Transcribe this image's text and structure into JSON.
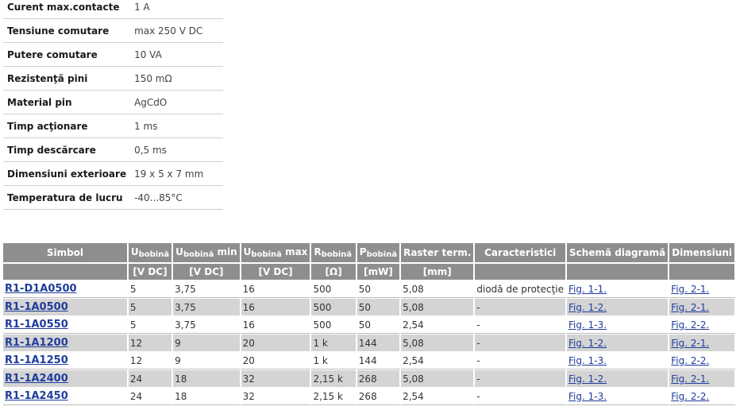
{
  "specs": [
    {
      "label": "Curent max.contacte",
      "value": "1 A"
    },
    {
      "label": "Tensiune comutare",
      "value": "max 250 V DC"
    },
    {
      "label": "Putere comutare",
      "value": "10 VA"
    },
    {
      "label": "Rezistenţă pini",
      "value": "150 mΩ"
    },
    {
      "label": "Material pin",
      "value": "AgCdO"
    },
    {
      "label": "Timp acţionare",
      "value": "1 ms"
    },
    {
      "label": "Timp descărcare",
      "value": "0,5 ms"
    },
    {
      "label": "Dimensiuni exterioare",
      "value": "19 x 5 x 7 mm"
    },
    {
      "label": "Temperatura de lucru",
      "value": "-40...85°C"
    }
  ],
  "table": {
    "headers": {
      "simbol": "Simbol",
      "u_bobina_main": "U",
      "u_bobina_sub": "bobină",
      "u_min_main": "U",
      "u_min_sub": "bobină",
      "u_min_suffix": " min",
      "u_max_main": "U",
      "u_max_sub": "bobină",
      "u_max_suffix": " max",
      "r_main": "R",
      "r_sub": "bobină",
      "p_main": "P",
      "p_sub": "bobină",
      "raster": "Raster term.",
      "caracteristici": "Caracteristici",
      "schema": "Schemă diagramă",
      "dimensiuni": "Dimensiuni"
    },
    "units": [
      "[V DC]",
      "[V DC]",
      "[V DC]",
      "[Ω]",
      "[mW]",
      "[mm]"
    ],
    "rows": [
      {
        "simbol": "R1-D1A0500",
        "u": "5",
        "umin": "3,75",
        "umax": "16",
        "r": "500",
        "p": "50",
        "raster": "5,08",
        "car": "diodă de protecţie",
        "schema": "Fig. 1-1.",
        "dim": "Fig. 2-1."
      },
      {
        "simbol": "R1-1A0500",
        "u": "5",
        "umin": "3,75",
        "umax": "16",
        "r": "500",
        "p": "50",
        "raster": "5,08",
        "car": "-",
        "schema": "Fig. 1-2.",
        "dim": "Fig. 2-1."
      },
      {
        "simbol": "R1-1A0550",
        "u": "5",
        "umin": "3,75",
        "umax": "16",
        "r": "500",
        "p": "50",
        "raster": "2,54",
        "car": "-",
        "schema": "Fig. 1-3.",
        "dim": "Fig. 2-2."
      },
      {
        "simbol": "R1-1A1200",
        "u": "12",
        "umin": "9",
        "umax": "20",
        "r": "1 k",
        "p": "144",
        "raster": "5,08",
        "car": "-",
        "schema": "Fig. 1-2.",
        "dim": "Fig. 2-1."
      },
      {
        "simbol": "R1-1A1250",
        "u": "12",
        "umin": "9",
        "umax": "20",
        "r": "1 k",
        "p": "144",
        "raster": "2,54",
        "car": "-",
        "schema": "Fig. 1-3.",
        "dim": "Fig. 2-2."
      },
      {
        "simbol": "R1-1A2400",
        "u": "24",
        "umin": "18",
        "umax": "32",
        "r": "2,15 k",
        "p": "268",
        "raster": "5,08",
        "car": "-",
        "schema": "Fig. 1-2.",
        "dim": "Fig. 2-1."
      },
      {
        "simbol": "R1-1A2450",
        "u": "24",
        "umin": "18",
        "umax": "32",
        "r": "2,15 k",
        "p": "268",
        "raster": "2,54",
        "car": "-",
        "schema": "Fig. 1-3.",
        "dim": "Fig. 2-2."
      }
    ]
  }
}
